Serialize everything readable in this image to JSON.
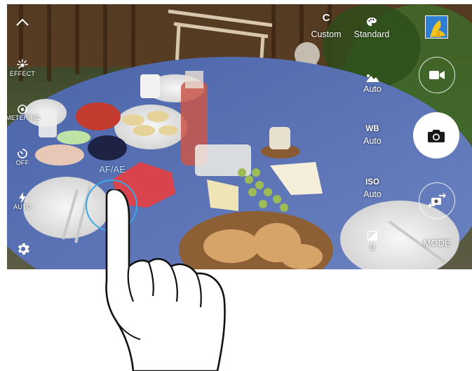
{
  "left_bar": {
    "effect_label": "EFFECT",
    "metering_label": "METERING",
    "timer_label": "OFF",
    "flash_label": "AUTO"
  },
  "top_bar": {
    "custom_letter": "C",
    "custom_label": "Custom",
    "filter_label": "Standard"
  },
  "right_bar": {
    "scene_value": "Auto",
    "wb_label": "WB",
    "wb_value": "Auto",
    "iso_label": "ISO",
    "iso_value": "Auto",
    "ev_value": "0",
    "mode_label": "MODE"
  },
  "focus": {
    "label": "AF/AE"
  },
  "colors": {
    "overlay_text": "#ffffff",
    "focus_ring": "#3aa7e8",
    "shutter_fill": "#ffffff",
    "shutter_icon": "#1a1a1a"
  },
  "icons": [
    "chevron-up-icon",
    "effect-icon",
    "metering-icon",
    "timer-icon",
    "flash-icon",
    "settings-gear-icon",
    "filter-palette-icon",
    "scene-mode-icon",
    "exposure-icon",
    "video-camera-icon",
    "camera-icon",
    "switch-camera-icon",
    "gallery-thumbnail"
  ]
}
